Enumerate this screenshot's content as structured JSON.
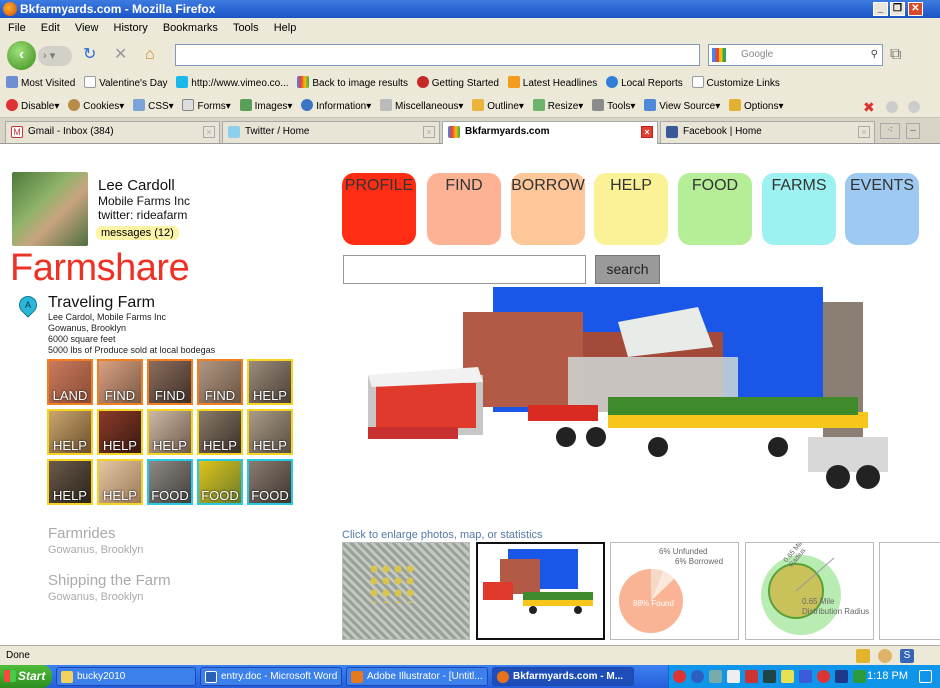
{
  "window": {
    "title": "Bkfarmyards.com - Mozilla Firefox"
  },
  "menu": [
    "File",
    "Edit",
    "View",
    "History",
    "Bookmarks",
    "Tools",
    "Help"
  ],
  "search": {
    "placeholder": "Google"
  },
  "bookmarks": [
    "Most Visited",
    "Valentine's Day",
    "http://www.vimeo.co...",
    "Back to image results",
    "Getting Started",
    "Latest Headlines",
    "Local Reports",
    "Customize Links"
  ],
  "webdev": [
    "Disable▾",
    "Cookies▾",
    "CSS▾",
    "Forms▾",
    "Images▾",
    "Information▾",
    "Miscellaneous▾",
    "Outline▾",
    "Resize▾",
    "Tools▾",
    "View Source▾",
    "Options▾"
  ],
  "tabs": [
    "Gmail - Inbox (384)",
    "Twitter / Home",
    "Bkfarmyards.com",
    "Facebook | Home"
  ],
  "profile": {
    "name": "Lee Cardoll",
    "org": "Mobile Farms Inc",
    "twitter": "twitter: rideafarm",
    "messages": "messages (12)"
  },
  "brand": "Farmshare",
  "farm": {
    "pin": "A",
    "title": "Traveling Farm",
    "line1": "Lee Cardol, Mobile Farms Inc",
    "line2": "Gowanus, Brooklyn",
    "line3": "6000 square feet",
    "line4": "5000 lbs of Produce sold at local bodegas"
  },
  "grid": [
    "LAND",
    "FIND",
    "FIND",
    "FIND",
    "HELP",
    "HELP",
    "HELP",
    "HELP",
    "HELP",
    "HELP",
    "HELP",
    "HELP",
    "FOOD",
    "FOOD",
    "FOOD"
  ],
  "sections": [
    {
      "title": "Farmrides",
      "sub": "Gowanus, Brooklyn"
    },
    {
      "title": "Shipping the Farm",
      "sub": "Gowanus, Brooklyn"
    }
  ],
  "nav": [
    {
      "label": "PROFILE",
      "color": "#ff2d13"
    },
    {
      "label": "FIND",
      "color": "#fdb393"
    },
    {
      "label": "BORROW",
      "color": "#fdc79a"
    },
    {
      "label": "HELP",
      "color": "#fbf196"
    },
    {
      "label": "FOOD",
      "color": "#b5ee97"
    },
    {
      "label": "FARMS",
      "color": "#9ef1f1"
    },
    {
      "label": "EVENTS",
      "color": "#9ec9f0"
    }
  ],
  "searchbtn": "search",
  "enlarge": "Click to enlarge photos, map, or statistics",
  "pie": {
    "unfunded": "6% Unfunded",
    "borrowed": "6% Borrowed",
    "found": "88% Found"
  },
  "radius": {
    "source": "0.65 Mile Source Radius",
    "dist": "0.65 Mile Distribution Radius"
  },
  "status": "Done",
  "taskbar": {
    "start": "Start",
    "items": [
      "bucky2010",
      "entry.doc - Microsoft Word",
      "Adobe Illustrator - [Untitl...",
      "Bkfarmyards.com - M..."
    ],
    "clock": "1:18 PM"
  }
}
